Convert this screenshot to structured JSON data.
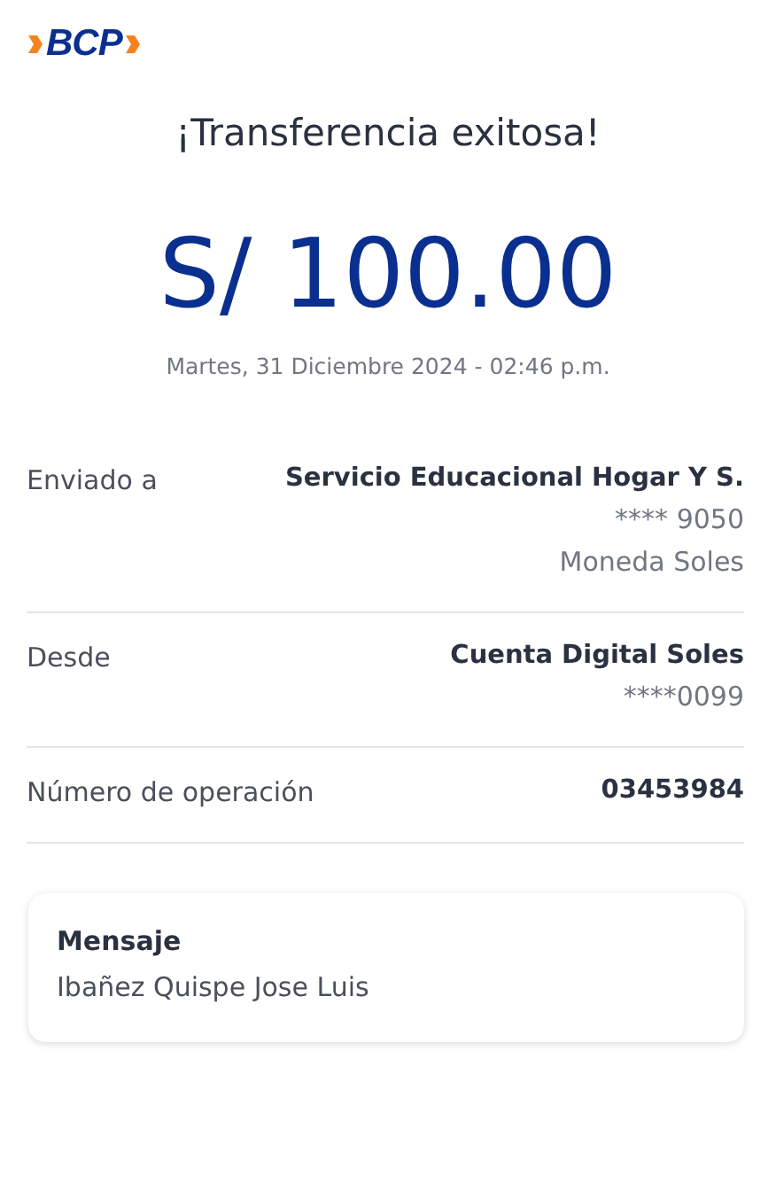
{
  "logo": {
    "text": "BCP"
  },
  "title": "¡Transferencia exitosa!",
  "amount": "S/ 100.00",
  "date": "Martes, 31 Diciembre 2024 - 02:46 p.m.",
  "details": [
    {
      "label": "Enviado a",
      "value": "Servicio Educacional Hogar Y S.",
      "extra": [
        "**** 9050",
        "Moneda Soles"
      ]
    },
    {
      "label": "Desde",
      "value": "Cuenta Digital Soles",
      "extra": [
        "****0099"
      ]
    },
    {
      "label": "Número de operación",
      "value": "03453984"
    }
  ],
  "message": {
    "label": "Mensaje",
    "text": "Ibañez Quispe Jose Luis"
  }
}
